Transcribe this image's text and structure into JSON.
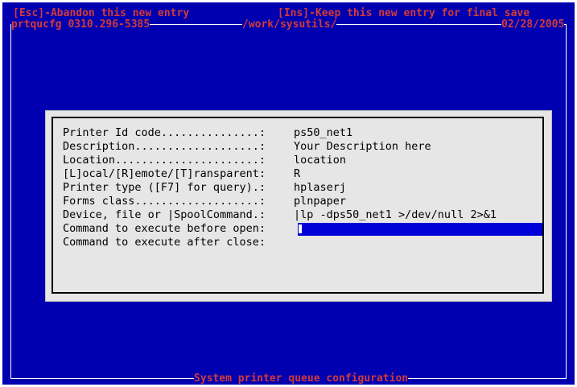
{
  "header": {
    "esc_hint": "[Esc]-Abandon this new entry",
    "ins_hint": "[Ins]-Keep this new entry for final save",
    "program_info": "prtqucfg 0310.296-5385",
    "path": "/work/sysutils/",
    "date": "02/28/2005"
  },
  "footer": {
    "title": "System printer queue configuration"
  },
  "form": {
    "fields": [
      {
        "label": "Printer Id code...............:",
        "value": "ps50_net1"
      },
      {
        "label": "Description...................:",
        "value": "Your Description here"
      },
      {
        "label": "Location......................:",
        "value": "location"
      },
      {
        "label": "[L]ocal/[R]emote/[T]ransparent:",
        "value": "R"
      },
      {
        "label": "Printer type ([F7] for query).:",
        "value": "hplaserj"
      },
      {
        "label": "Forms class...................:",
        "value": "plnpaper"
      },
      {
        "label": "Device, file or |SpoolCommand.:",
        "value": "|lp -dps50_net1 >/dev/null 2>&1"
      },
      {
        "label": "Command to execute before open:",
        "value": ""
      },
      {
        "label": "Command to execute after close:",
        "value": ""
      }
    ]
  },
  "colors": {
    "background": "#0000b0",
    "hint_text": "#d23a3a",
    "panel": "#e6e6e6",
    "active_field": "#0000d8"
  }
}
